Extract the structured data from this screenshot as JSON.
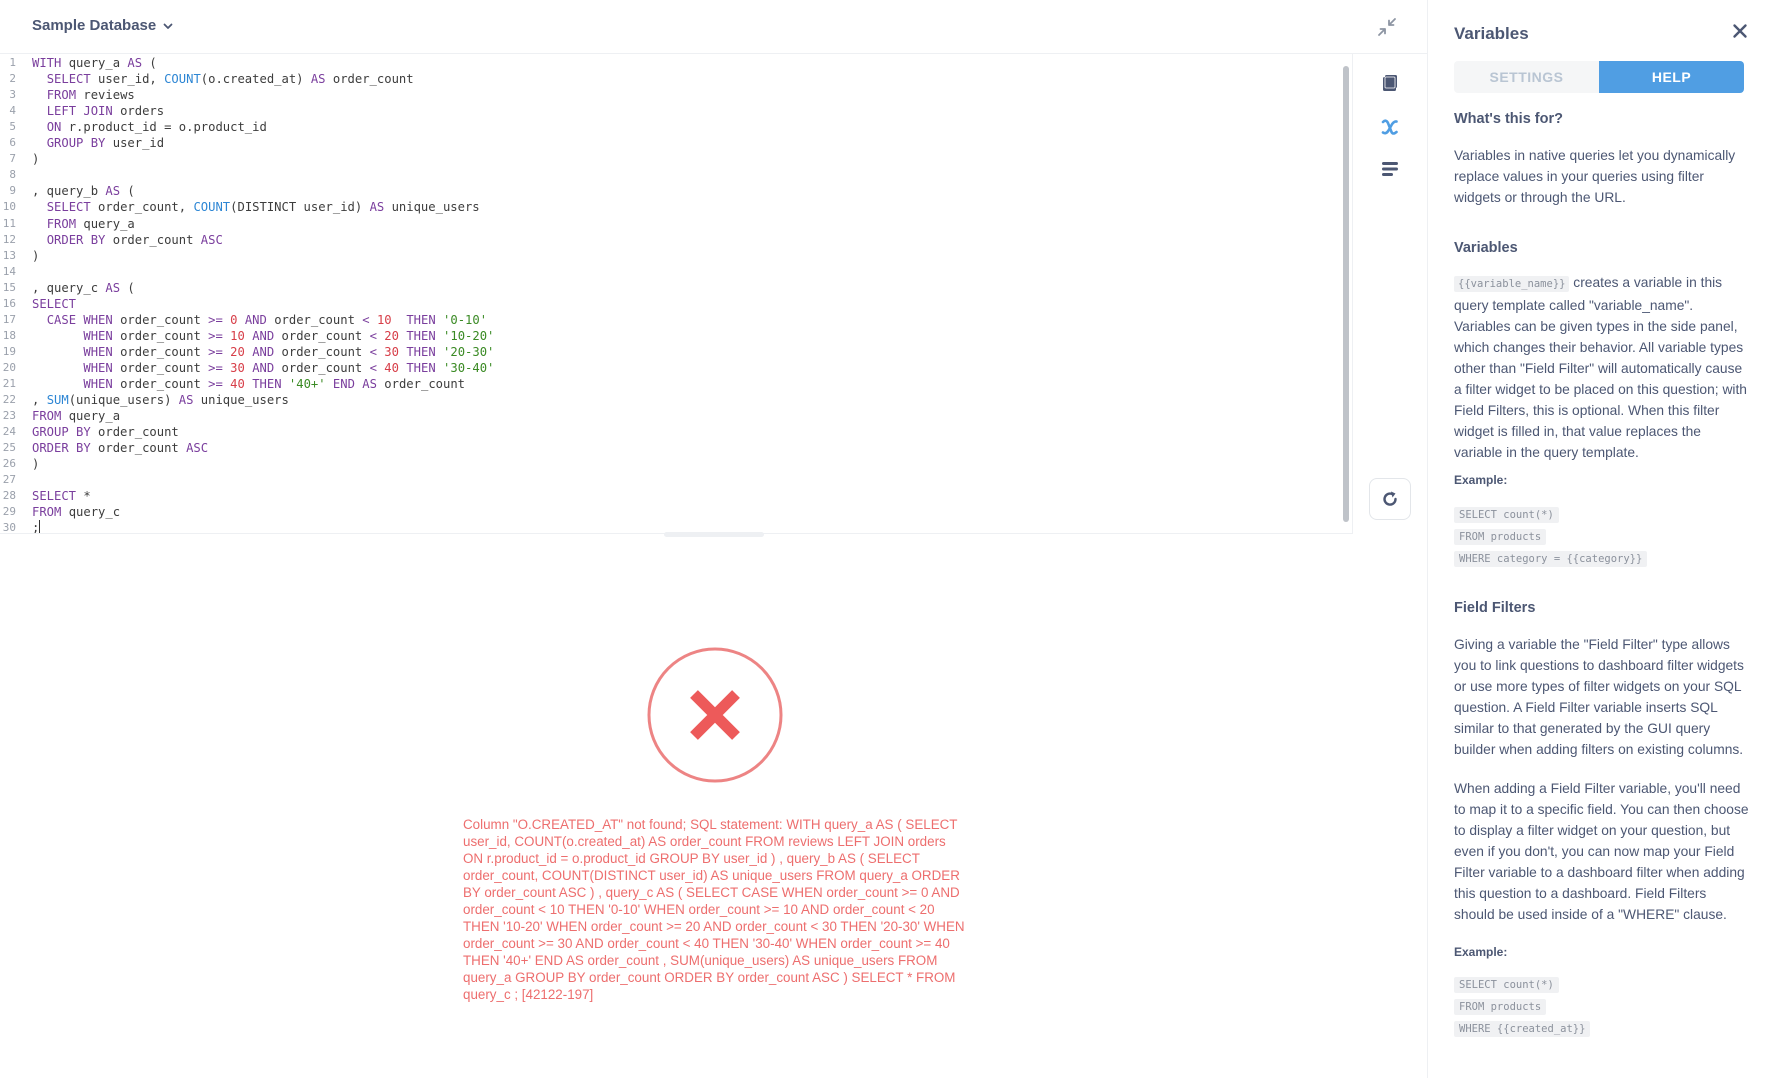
{
  "header": {
    "database_name": "Sample Database"
  },
  "editor": {
    "lines": [
      {
        "n": "1",
        "tokens": [
          {
            "t": "kw",
            "v": "WITH"
          },
          {
            "t": "plain",
            "v": " query_a "
          },
          {
            "t": "kw",
            "v": "AS"
          },
          {
            "t": "plain",
            "v": " ("
          }
        ]
      },
      {
        "n": "2",
        "tokens": [
          {
            "t": "plain",
            "v": "  "
          },
          {
            "t": "kw",
            "v": "SELECT"
          },
          {
            "t": "plain",
            "v": " user_id, "
          },
          {
            "t": "fn",
            "v": "COUNT"
          },
          {
            "t": "plain",
            "v": "(o.created_at) "
          },
          {
            "t": "kw",
            "v": "AS"
          },
          {
            "t": "plain",
            "v": " order_count"
          }
        ]
      },
      {
        "n": "3",
        "tokens": [
          {
            "t": "plain",
            "v": "  "
          },
          {
            "t": "kw",
            "v": "FROM"
          },
          {
            "t": "plain",
            "v": " reviews"
          }
        ]
      },
      {
        "n": "4",
        "tokens": [
          {
            "t": "plain",
            "v": "  "
          },
          {
            "t": "kw",
            "v": "LEFT JOIN"
          },
          {
            "t": "plain",
            "v": " orders"
          }
        ]
      },
      {
        "n": "5",
        "tokens": [
          {
            "t": "plain",
            "v": "  "
          },
          {
            "t": "kw",
            "v": "ON"
          },
          {
            "t": "plain",
            "v": " r.product_id = o.product_id"
          }
        ]
      },
      {
        "n": "6",
        "tokens": [
          {
            "t": "plain",
            "v": "  "
          },
          {
            "t": "kw",
            "v": "GROUP BY"
          },
          {
            "t": "plain",
            "v": " user_id"
          }
        ]
      },
      {
        "n": "7",
        "tokens": [
          {
            "t": "plain",
            "v": ")"
          }
        ]
      },
      {
        "n": "8",
        "tokens": []
      },
      {
        "n": "9",
        "tokens": [
          {
            "t": "plain",
            "v": ", query_b "
          },
          {
            "t": "kw",
            "v": "AS"
          },
          {
            "t": "plain",
            "v": " ("
          }
        ]
      },
      {
        "n": "10",
        "tokens": [
          {
            "t": "plain",
            "v": "  "
          },
          {
            "t": "kw",
            "v": "SELECT"
          },
          {
            "t": "plain",
            "v": " order_count, "
          },
          {
            "t": "fn",
            "v": "COUNT"
          },
          {
            "t": "plain",
            "v": "(DISTINCT user_id) "
          },
          {
            "t": "kw",
            "v": "AS"
          },
          {
            "t": "plain",
            "v": " unique_users"
          }
        ]
      },
      {
        "n": "11",
        "tokens": [
          {
            "t": "plain",
            "v": "  "
          },
          {
            "t": "kw",
            "v": "FROM"
          },
          {
            "t": "plain",
            "v": " query_a"
          }
        ]
      },
      {
        "n": "12",
        "tokens": [
          {
            "t": "plain",
            "v": "  "
          },
          {
            "t": "kw",
            "v": "ORDER BY"
          },
          {
            "t": "plain",
            "v": " order_count "
          },
          {
            "t": "kw",
            "v": "ASC"
          }
        ]
      },
      {
        "n": "13",
        "tokens": [
          {
            "t": "plain",
            "v": ")"
          }
        ]
      },
      {
        "n": "14",
        "tokens": []
      },
      {
        "n": "15",
        "tokens": [
          {
            "t": "plain",
            "v": ", query_c "
          },
          {
            "t": "kw",
            "v": "AS"
          },
          {
            "t": "plain",
            "v": " ("
          }
        ]
      },
      {
        "n": "16",
        "tokens": [
          {
            "t": "kw",
            "v": "SELECT"
          }
        ]
      },
      {
        "n": "17",
        "tokens": [
          {
            "t": "plain",
            "v": "  "
          },
          {
            "t": "kw",
            "v": "CASE WHEN"
          },
          {
            "t": "plain",
            "v": " order_count "
          },
          {
            "t": "kw",
            "v": ">="
          },
          {
            "t": "plain",
            "v": " "
          },
          {
            "t": "num",
            "v": "0"
          },
          {
            "t": "plain",
            "v": " "
          },
          {
            "t": "kw",
            "v": "AND"
          },
          {
            "t": "plain",
            "v": " order_count "
          },
          {
            "t": "kw",
            "v": "<"
          },
          {
            "t": "plain",
            "v": " "
          },
          {
            "t": "num",
            "v": "10"
          },
          {
            "t": "plain",
            "v": "  "
          },
          {
            "t": "kw",
            "v": "THEN"
          },
          {
            "t": "plain",
            "v": " "
          },
          {
            "t": "str",
            "v": "'0-10'"
          }
        ]
      },
      {
        "n": "18",
        "tokens": [
          {
            "t": "plain",
            "v": "       "
          },
          {
            "t": "kw",
            "v": "WHEN"
          },
          {
            "t": "plain",
            "v": " order_count "
          },
          {
            "t": "kw",
            "v": ">="
          },
          {
            "t": "plain",
            "v": " "
          },
          {
            "t": "num",
            "v": "10"
          },
          {
            "t": "plain",
            "v": " "
          },
          {
            "t": "kw",
            "v": "AND"
          },
          {
            "t": "plain",
            "v": " order_count "
          },
          {
            "t": "kw",
            "v": "<"
          },
          {
            "t": "plain",
            "v": " "
          },
          {
            "t": "num",
            "v": "20"
          },
          {
            "t": "plain",
            "v": " "
          },
          {
            "t": "kw",
            "v": "THEN"
          },
          {
            "t": "plain",
            "v": " "
          },
          {
            "t": "str",
            "v": "'10-20'"
          }
        ]
      },
      {
        "n": "19",
        "tokens": [
          {
            "t": "plain",
            "v": "       "
          },
          {
            "t": "kw",
            "v": "WHEN"
          },
          {
            "t": "plain",
            "v": " order_count "
          },
          {
            "t": "kw",
            "v": ">="
          },
          {
            "t": "plain",
            "v": " "
          },
          {
            "t": "num",
            "v": "20"
          },
          {
            "t": "plain",
            "v": " "
          },
          {
            "t": "kw",
            "v": "AND"
          },
          {
            "t": "plain",
            "v": " order_count "
          },
          {
            "t": "kw",
            "v": "<"
          },
          {
            "t": "plain",
            "v": " "
          },
          {
            "t": "num",
            "v": "30"
          },
          {
            "t": "plain",
            "v": " "
          },
          {
            "t": "kw",
            "v": "THEN"
          },
          {
            "t": "plain",
            "v": " "
          },
          {
            "t": "str",
            "v": "'20-30'"
          }
        ]
      },
      {
        "n": "20",
        "tokens": [
          {
            "t": "plain",
            "v": "       "
          },
          {
            "t": "kw",
            "v": "WHEN"
          },
          {
            "t": "plain",
            "v": " order_count "
          },
          {
            "t": "kw",
            "v": ">="
          },
          {
            "t": "plain",
            "v": " "
          },
          {
            "t": "num",
            "v": "30"
          },
          {
            "t": "plain",
            "v": " "
          },
          {
            "t": "kw",
            "v": "AND"
          },
          {
            "t": "plain",
            "v": " order_count "
          },
          {
            "t": "kw",
            "v": "<"
          },
          {
            "t": "plain",
            "v": " "
          },
          {
            "t": "num",
            "v": "40"
          },
          {
            "t": "plain",
            "v": " "
          },
          {
            "t": "kw",
            "v": "THEN"
          },
          {
            "t": "plain",
            "v": " "
          },
          {
            "t": "str",
            "v": "'30-40'"
          }
        ]
      },
      {
        "n": "21",
        "tokens": [
          {
            "t": "plain",
            "v": "       "
          },
          {
            "t": "kw",
            "v": "WHEN"
          },
          {
            "t": "plain",
            "v": " order_count "
          },
          {
            "t": "kw",
            "v": ">="
          },
          {
            "t": "plain",
            "v": " "
          },
          {
            "t": "num",
            "v": "40"
          },
          {
            "t": "plain",
            "v": " "
          },
          {
            "t": "kw",
            "v": "THEN"
          },
          {
            "t": "plain",
            "v": " "
          },
          {
            "t": "str",
            "v": "'40+'"
          },
          {
            "t": "plain",
            "v": " "
          },
          {
            "t": "kw",
            "v": "END AS"
          },
          {
            "t": "plain",
            "v": " order_count"
          }
        ]
      },
      {
        "n": "22",
        "tokens": [
          {
            "t": "plain",
            "v": ", "
          },
          {
            "t": "fn",
            "v": "SUM"
          },
          {
            "t": "plain",
            "v": "(unique_users) "
          },
          {
            "t": "kw",
            "v": "AS"
          },
          {
            "t": "plain",
            "v": " unique_users"
          }
        ]
      },
      {
        "n": "23",
        "tokens": [
          {
            "t": "kw",
            "v": "FROM"
          },
          {
            "t": "plain",
            "v": " query_a"
          }
        ]
      },
      {
        "n": "24",
        "tokens": [
          {
            "t": "kw",
            "v": "GROUP BY"
          },
          {
            "t": "plain",
            "v": " order_count"
          }
        ]
      },
      {
        "n": "25",
        "tokens": [
          {
            "t": "kw",
            "v": "ORDER BY"
          },
          {
            "t": "plain",
            "v": " order_count "
          },
          {
            "t": "kw",
            "v": "ASC"
          }
        ]
      },
      {
        "n": "26",
        "tokens": [
          {
            "t": "plain",
            "v": ")"
          }
        ]
      },
      {
        "n": "27",
        "tokens": []
      },
      {
        "n": "28",
        "tokens": [
          {
            "t": "kw",
            "v": "SELECT"
          },
          {
            "t": "plain",
            "v": " *"
          }
        ]
      },
      {
        "n": "29",
        "tokens": [
          {
            "t": "kw",
            "v": "FROM"
          },
          {
            "t": "plain",
            "v": " query_c"
          }
        ]
      },
      {
        "n": "30",
        "tokens": [
          {
            "t": "plain",
            "v": ";"
          }
        ],
        "cursor": true
      }
    ]
  },
  "tools": {
    "icons": [
      "book-icon",
      "variable-x-icon",
      "snippet-lines-icon",
      "refresh-icon",
      "collapse-icon",
      "chevron-down-icon",
      "close-icon",
      "error-x-icon"
    ]
  },
  "error": {
    "message": "Column \"O.CREATED_AT\" not found; SQL statement: WITH query_a AS ( SELECT user_id, COUNT(o.created_at) AS order_count FROM reviews LEFT JOIN orders ON r.product_id = o.product_id GROUP BY user_id ) , query_b AS ( SELECT order_count, COUNT(DISTINCT user_id) AS unique_users FROM query_a ORDER BY order_count ASC ) , query_c AS ( SELECT CASE WHEN order_count >= 0 AND order_count < 10 THEN '0-10' WHEN order_count >= 10 AND order_count < 20 THEN '10-20' WHEN order_count >= 20 AND order_count < 30 THEN '20-30' WHEN order_count >= 30 AND order_count < 40 THEN '30-40' WHEN order_count >= 40 THEN '40+' END AS order_count , SUM(unique_users) AS unique_users FROM query_a GROUP BY order_count ORDER BY order_count ASC ) SELECT * FROM query_c ; [42122-197]",
    "color": "#ed6e6e"
  },
  "sidebar": {
    "title": "Variables",
    "tabs": [
      {
        "label": "SETTINGS",
        "active": false
      },
      {
        "label": "HELP",
        "active": true
      }
    ],
    "whats_this_for_heading": "What's this for?",
    "whats_this_for_text": "Variables in native queries let you dynamically replace values in your queries using filter widgets or through the URL.",
    "variables_heading": "Variables",
    "variables_chip": "{{variable_name}}",
    "variables_text": " creates a variable in this query template called \"variable_name\". Variables can be given types in the side panel, which changes their behavior. All variable types other than \"Field Filter\" will automatically cause a filter widget to be placed on this question; with Field Filters, this is optional. When this filter widget is filled in, that value replaces the variable in the query template.",
    "example_label_1": "Example:",
    "example_1": [
      "SELECT count(*)",
      "FROM products",
      "WHERE category = {{category}}"
    ],
    "field_filters_heading": "Field Filters",
    "field_filters_text_1": "Giving a variable the \"Field Filter\" type allows you to link questions to dashboard filter widgets or use more types of filter widgets on your SQL question. A Field Filter variable inserts SQL similar to that generated by the GUI query builder when adding filters on existing columns.",
    "field_filters_text_2": "When adding a Field Filter variable, you'll need to map it to a specific field. You can then choose to display a filter widget on your question, but even if you don't, you can now map your Field Filter variable to a dashboard filter when adding this question to a dashboard. Field Filters should be used inside of a \"WHERE\" clause.",
    "example_label_2": "Example:",
    "example_2": [
      "SELECT count(*)",
      "FROM products",
      "WHERE {{created_at}}"
    ]
  },
  "colors": {
    "accent": "#509ee3",
    "text": "#4c5773",
    "error": "#ed6e6e",
    "keyword": "#7a3e9d",
    "function": "#2d86d4",
    "number": "#d73e48",
    "string": "#3a8a24"
  }
}
